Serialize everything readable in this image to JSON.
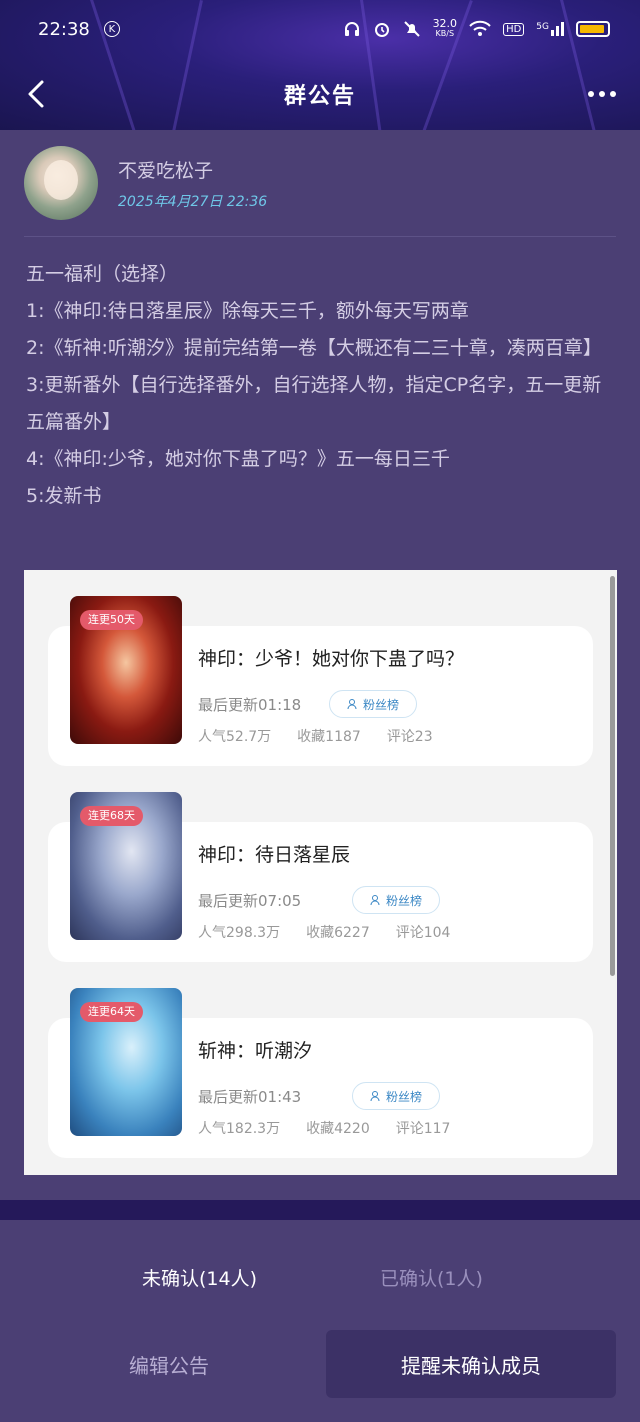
{
  "status_bar": {
    "time": "22:38",
    "k_badge": "K",
    "net_speed": "32.0",
    "net_unit": "KB/S",
    "hd": "HD",
    "signal": "5G"
  },
  "header": {
    "title": "群公告"
  },
  "author": {
    "name": "不爱吃松子",
    "timestamp": "2025年4月27日 22:36"
  },
  "announcement": {
    "lines": [
      "五一福利（选择）",
      "1:《神印:待日落星辰》除每天三千，额外每天写两章",
      "2:《斩神:听潮汐》提前完结第一卷【大概还有二三十章，凑两百章】",
      "3:更新番外【自行选择番外，自行选择人物，指定CP名字，五一更新五篇番外】",
      "4:《神印:少爷，她对你下蛊了吗？》五一每日三千",
      "5:发新书"
    ]
  },
  "books": [
    {
      "tag": "连更50天",
      "title": "神印：少爷！她对你下蛊了吗？",
      "last_update": "最后更新01:18",
      "fan_label": "粉丝榜",
      "popularity": "人气52.7万",
      "favorites": "收藏1187",
      "comments": "评论23"
    },
    {
      "tag": "连更68天",
      "title": "神印：待日落星辰",
      "last_update": "最后更新07:05",
      "fan_label": "粉丝榜",
      "popularity": "人气298.3万",
      "favorites": "收藏6227",
      "comments": "评论104"
    },
    {
      "tag": "连更64天",
      "title": "斩神：听潮汐",
      "last_update": "最后更新01:43",
      "fan_label": "粉丝榜",
      "popularity": "人气182.3万",
      "favorites": "收藏4220",
      "comments": "评论117"
    }
  ],
  "tabs": {
    "unconfirmed": "未确认(14人)",
    "confirmed": "已确认(1人)"
  },
  "actions": {
    "edit": "编辑公告",
    "remind": "提醒未确认成员"
  },
  "colors": {
    "background": "#4b3f74",
    "timestamp": "#6fc7e8",
    "tag": "#e45a6a",
    "battery": "#f5b800"
  }
}
